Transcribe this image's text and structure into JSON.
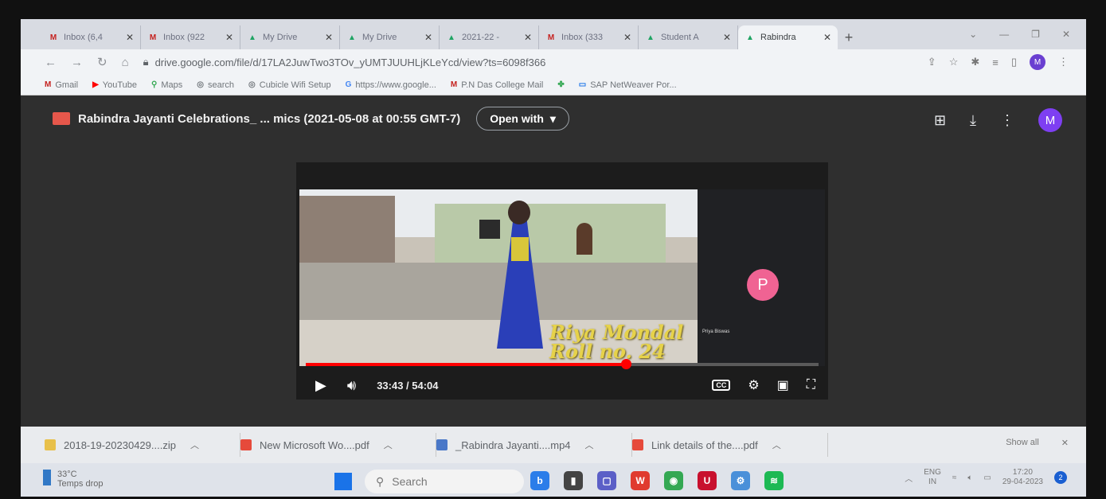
{
  "browser": {
    "tabs": [
      {
        "label": "Inbox (6,4",
        "icon": "gmail-icon",
        "active": false
      },
      {
        "label": "Inbox (922",
        "icon": "gmail-icon",
        "active": false
      },
      {
        "label": "My Drive",
        "icon": "drive-icon",
        "active": false
      },
      {
        "label": "My Drive",
        "icon": "drive-icon",
        "active": false
      },
      {
        "label": "2021-22 -",
        "icon": "drive-icon",
        "active": false
      },
      {
        "label": "Inbox (333",
        "icon": "gmail-icon",
        "active": false
      },
      {
        "label": "Student A",
        "icon": "drive-icon",
        "active": false
      },
      {
        "label": "Rabindra",
        "icon": "drive-icon",
        "active": true
      }
    ],
    "new_tab": "+",
    "url": "drive.google.com/file/d/17LA2JuwTwo3TOv_yUMTJUUHLjKLeYcd/view?ts=6098f366",
    "profile_initial": "M",
    "bookmarks": [
      {
        "label": "Gmail",
        "icon": "gmail-icon"
      },
      {
        "label": "YouTube",
        "icon": "youtube-icon"
      },
      {
        "label": "Maps",
        "icon": "maps-icon"
      },
      {
        "label": "search",
        "icon": "globe-icon"
      },
      {
        "label": "Cubicle Wifi Setup",
        "icon": "globe-icon"
      },
      {
        "label": "https://www.google...",
        "icon": "google-icon"
      },
      {
        "label": "P.N Das College Mail",
        "icon": "gmail-icon"
      },
      {
        "label": "",
        "icon": "pinwheel-icon"
      },
      {
        "label": "SAP NetWeaver Por...",
        "icon": "sap-icon"
      }
    ]
  },
  "viewer": {
    "file_title": "Rabindra Jayanti Celebrations_ ... mics (2021-05-08 at 00:55 GMT-7)",
    "open_with": "Open with",
    "avatar_initial": "M"
  },
  "player": {
    "time": "33:43 / 54:04",
    "progress": 0.624,
    "participant_initial": "P",
    "participant_name": "Priya Biswas",
    "watermark_line1": "Riya Mondal",
    "watermark_line2": "Roll no. 24",
    "cc_label": "CC"
  },
  "downloads": {
    "items": [
      {
        "label": "2018-19-20230429....zip",
        "color": "#e8c04a"
      },
      {
        "label": "New Microsoft Wo....pdf",
        "color": "#e64a3b"
      },
      {
        "label": "_Rabindra Jayanti....mp4",
        "color": "#4a78c8"
      },
      {
        "label": "Link details of the....pdf",
        "color": "#e64a3b"
      }
    ],
    "show_all": "Show all",
    "close": "✕"
  },
  "taskbar": {
    "temp": "33°C",
    "weather_text": "Temps drop",
    "search_placeholder": "Search",
    "lang_line1": "ENG",
    "lang_line2": "IN",
    "clock_time": "17:20",
    "clock_date": "29-04-2023",
    "notification_count": "2"
  }
}
